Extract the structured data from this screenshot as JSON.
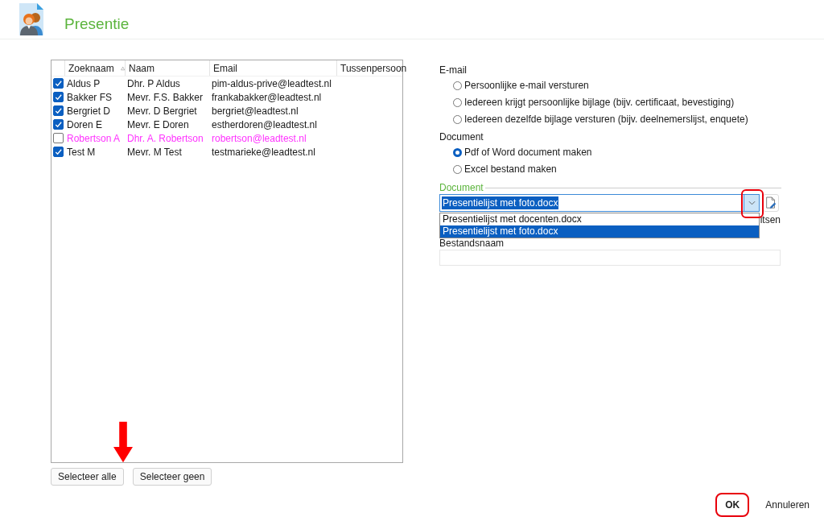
{
  "header": {
    "title": "Presentie"
  },
  "table": {
    "columns": [
      {
        "label": "Zoeknaam",
        "sorted": true
      },
      {
        "label": "Naam",
        "sorted": false
      },
      {
        "label": "Email",
        "sorted": false
      },
      {
        "label": "Tussenpersoon",
        "sorted": false
      }
    ],
    "rows": [
      {
        "checked": true,
        "color": "#1a1a1a",
        "cells": [
          "Aldus P",
          "Dhr. P Aldus",
          "pim-aldus-prive@leadtest.nl"
        ]
      },
      {
        "checked": true,
        "color": "#1a1a1a",
        "cells": [
          "Bakker FS",
          "Mevr. F.S. Bakker",
          "frankabakker@leadtest.nl"
        ]
      },
      {
        "checked": true,
        "color": "#1a1a1a",
        "cells": [
          "Bergriet D",
          "Mevr. D Bergriet",
          "bergriet@leadtest.nl"
        ]
      },
      {
        "checked": true,
        "color": "#1a1a1a",
        "cells": [
          "Doren E",
          "Mevr. E Doren",
          "estherdoren@leadtest.nl"
        ]
      },
      {
        "checked": false,
        "color": "#ff33ff",
        "cells": [
          "Robertson A",
          "Dhr. A. Robertson",
          "robertson@leadtest.nl"
        ]
      },
      {
        "checked": true,
        "color": "#1a1a1a",
        "cells": [
          "Test M",
          "Mevr. M Test",
          "testmarieke@leadtest.nl"
        ]
      }
    ]
  },
  "table_buttons": [
    "Selecteer alle",
    "Selecteer geen"
  ],
  "email_section": {
    "label": "E-mail",
    "options": [
      {
        "label": "Persoonlijke e-mail versturen",
        "selected": false
      },
      {
        "label": "Iedereen krijgt persoonlijke bijlage (bijv. certificaat, bevestiging)",
        "selected": false
      },
      {
        "label": "Iedereen dezelfde bijlage versturen (bijv. deelnemerslijst, enquete)",
        "selected": false
      }
    ]
  },
  "document_section": {
    "label": "Document",
    "options": [
      {
        "label": "Pdf of Word document maken",
        "selected": true
      },
      {
        "label": "Excel bestand maken",
        "selected": false
      }
    ]
  },
  "document_group": {
    "label": "Document",
    "combo": {
      "value": "Presentielijst met foto.docx",
      "expanded": true,
      "options": [
        {
          "label": "Presentielijst met docenten.docx",
          "selected": false
        },
        {
          "label": "Presentielijst met foto.docx",
          "selected": true
        }
      ]
    },
    "side_text": "itsen",
    "filename": {
      "label": "Bestandsnaam"
    }
  },
  "footer_buttons": [
    {
      "label": "OK",
      "default": true
    },
    {
      "label": "Annuleren",
      "default": false
    }
  ]
}
